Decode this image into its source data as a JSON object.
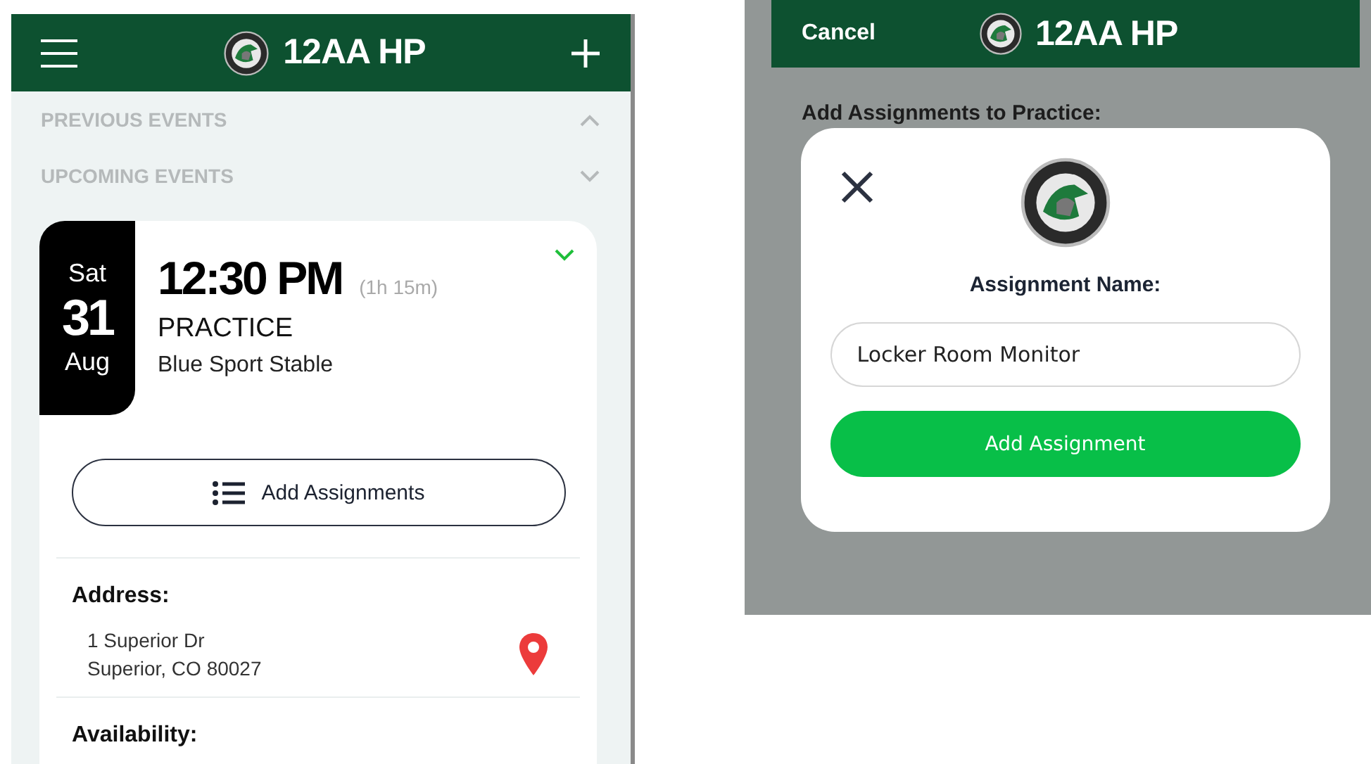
{
  "events_screen": {
    "header": {
      "title": "12AA HP"
    },
    "sections": [
      {
        "label": "PREVIOUS EVENTS",
        "expanded": true
      },
      {
        "label": "UPCOMING EVENTS",
        "expanded": false
      }
    ],
    "event": {
      "weekday": "Sat",
      "day": "31",
      "month": "Aug",
      "time": "12:30 PM",
      "duration": "(1h 15m)",
      "type": "PRACTICE",
      "location": "Blue Sport Stable",
      "assign_button": "Add Assignments",
      "address_label": "Address:",
      "address_lines": [
        "1 Superior Dr",
        "Superior, CO 80027"
      ],
      "availability_label": "Availability:"
    }
  },
  "assignment_screen": {
    "header": {
      "cancel": "Cancel",
      "title": "12AA HP"
    },
    "heading": "Add Assignments to Practice:",
    "dialog": {
      "label": "Assignment Name:",
      "value": "Locker Room Monitor",
      "button": "Add Assignment"
    }
  }
}
